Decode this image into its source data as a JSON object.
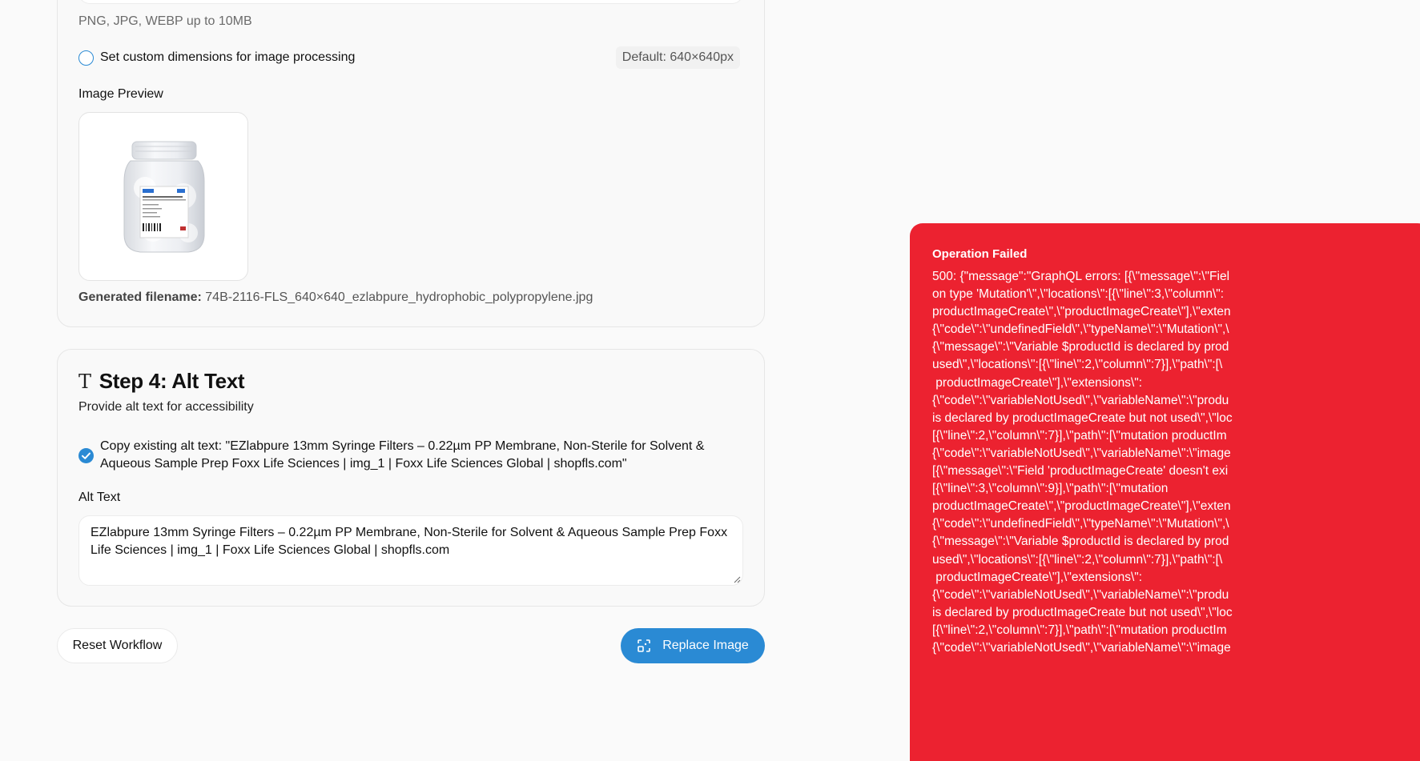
{
  "upload": {
    "hint": "PNG, JPG, WEBP up to 10MB",
    "custom_dimensions_label": "Set custom dimensions for image processing",
    "default_dimensions": "Default: 640×640px",
    "preview_label": "Image Preview",
    "filename_label": "Generated filename:",
    "filename_value": "74B-2116-FLS_640×640_ezlabpure_hydrophobic_polypropylene.jpg"
  },
  "step4": {
    "title": "Step 4: Alt Text",
    "subtitle": "Provide alt text for accessibility",
    "copy_existing_label": "Copy existing alt text: \"EZlabpure 13mm Syringe Filters – 0.22µm PP Membrane, Non-Sterile for Solvent & Aqueous Sample Prep Foxx Life Sciences | img_1 | Foxx Life Sciences Global | shopfls.com\"",
    "copy_existing_checked": true,
    "alt_text_label": "Alt Text",
    "alt_text_value": "EZlabpure 13mm Syringe Filters – 0.22µm PP Membrane, Non-Sterile for Solvent & Aqueous Sample Prep Foxx Life Sciences | img_1 | Foxx Life Sciences Global | shopfls.com"
  },
  "actions": {
    "reset_label": "Reset Workflow",
    "replace_label": "Replace Image"
  },
  "toast": {
    "title": "Operation Failed",
    "message": "500: {\"message\":\"GraphQL errors: [{\\\"message\\\":\\\"Fiel\non type 'Mutation'\\\",\\\"locations\\\":[{\\\"line\\\":3,\\\"column\\\":\nproductImageCreate\\\",\\\"productImageCreate\\\"],\\\"exten\n{\\\"code\\\":\\\"undefinedField\\\",\\\"typeName\\\":\\\"Mutation\\\",\\\n{\\\"message\\\":\\\"Variable $productId is declared by prod\nused\\\",\\\"locations\\\":[{\\\"line\\\":2,\\\"column\\\":7}],\\\"path\\\":[\\\n productImageCreate\\\"],\\\"extensions\\\":\n{\\\"code\\\":\\\"variableNotUsed\\\",\\\"variableName\\\":\\\"produ\nis declared by productImageCreate but not used\\\",\\\"loc\n[{\\\"line\\\":2,\\\"column\\\":7}],\\\"path\\\":[\\\"mutation productIm\n{\\\"code\\\":\\\"variableNotUsed\\\",\\\"variableName\\\":\\\"image\n[{\\\"message\\\":\\\"Field 'productImageCreate' doesn't exi\n[{\\\"line\\\":3,\\\"column\\\":9}],\\\"path\\\":[\\\"mutation\nproductImageCreate\\\",\\\"productImageCreate\\\"],\\\"exten\n{\\\"code\\\":\\\"undefinedField\\\",\\\"typeName\\\":\\\"Mutation\\\",\\\n{\\\"message\\\":\\\"Variable $productId is declared by prod\nused\\\",\\\"locations\\\":[{\\\"line\\\":2,\\\"column\\\":7}],\\\"path\\\":[\\\n productImageCreate\\\"],\\\"extensions\\\":\n{\\\"code\\\":\\\"variableNotUsed\\\",\\\"variableName\\\":\\\"produ\nis declared by productImageCreate but not used\\\",\\\"loc\n[{\\\"line\\\":2,\\\"column\\\":7}],\\\"path\\\":[\\\"mutation productIm\n{\\\"code\\\":\\\"variableNotUsed\\\",\\\"variableName\\\":\\\"image"
  },
  "colors": {
    "accent": "#2a8ad4",
    "error": "#ec2230"
  }
}
